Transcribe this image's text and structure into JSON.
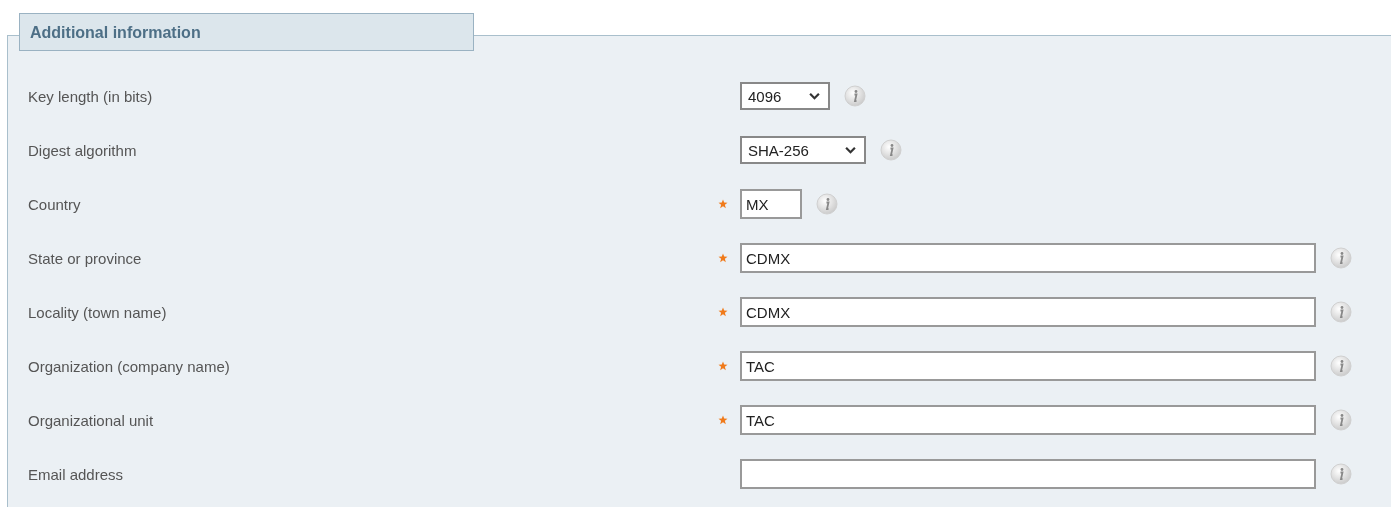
{
  "section": {
    "title": "Additional information"
  },
  "fields": [
    {
      "label": "Key length (in bits)",
      "kind": "select",
      "value": "4096",
      "required": false
    },
    {
      "label": "Digest algorithm",
      "kind": "select-wide",
      "value": "SHA-256",
      "required": false
    },
    {
      "label": "Country",
      "kind": "short",
      "value": "MX",
      "required": true
    },
    {
      "label": "State or province",
      "kind": "full",
      "value": "CDMX",
      "required": true
    },
    {
      "label": "Locality (town name)",
      "kind": "full",
      "value": "CDMX",
      "required": true
    },
    {
      "label": "Organization (company name)",
      "kind": "full",
      "value": "TAC",
      "required": true
    },
    {
      "label": "Organizational unit",
      "kind": "full",
      "value": "TAC",
      "required": true
    },
    {
      "label": "Email address",
      "kind": "full",
      "required": false
    }
  ]
}
